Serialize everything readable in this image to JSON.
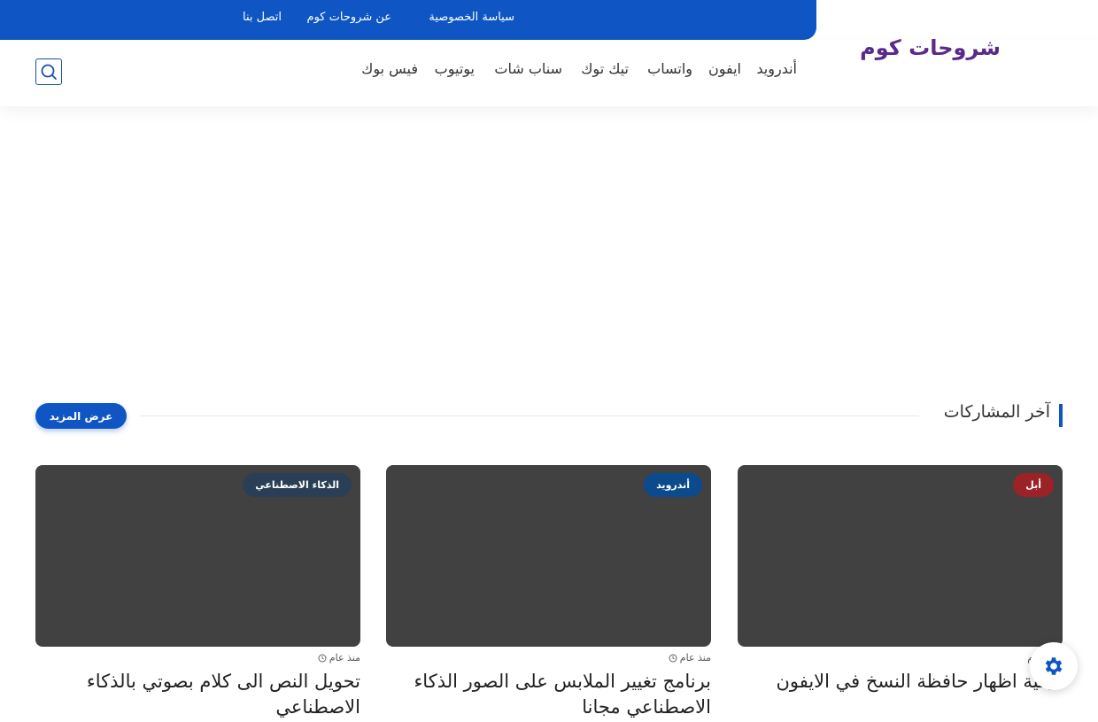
{
  "topbar": {
    "links": [
      "سياسة الخصوصية",
      "عن شروحات كوم",
      "اتصل بنا"
    ]
  },
  "header": {
    "logo": "شروحات كوم",
    "nav": [
      "أندرويد",
      "ايفون",
      "واتساب",
      "تيك توك",
      "سناب شات",
      "يوتيوب",
      "فيس بوك"
    ],
    "search_icon": "search-icon"
  },
  "latest": {
    "title": "آخر المشاركات",
    "more_label": "عرض المزيد"
  },
  "posts": [
    {
      "category": "أبل",
      "category_color": "#9b2226",
      "time": "6 أيام",
      "title": "كيفية اظهار حافظة النسخ في الايفون"
    },
    {
      "category": "أندرويد",
      "category_color": "#0b4a8c",
      "time": "منذ عام",
      "title": "برنامج تغيير الملابس على الصور الذكاء الاصطناعي مجانا"
    },
    {
      "category": "الذكاء الاصطناعي",
      "category_color": "#2a3f55",
      "time": "منذ عام",
      "title": "تحويل النص الى كلام بصوتي بالذكاء الاصطناعي"
    }
  ],
  "colors": {
    "brand": "#0f56c4",
    "logo": "#5a2a8a",
    "thumb": "#414141"
  },
  "settings_icon": "gear-icon"
}
